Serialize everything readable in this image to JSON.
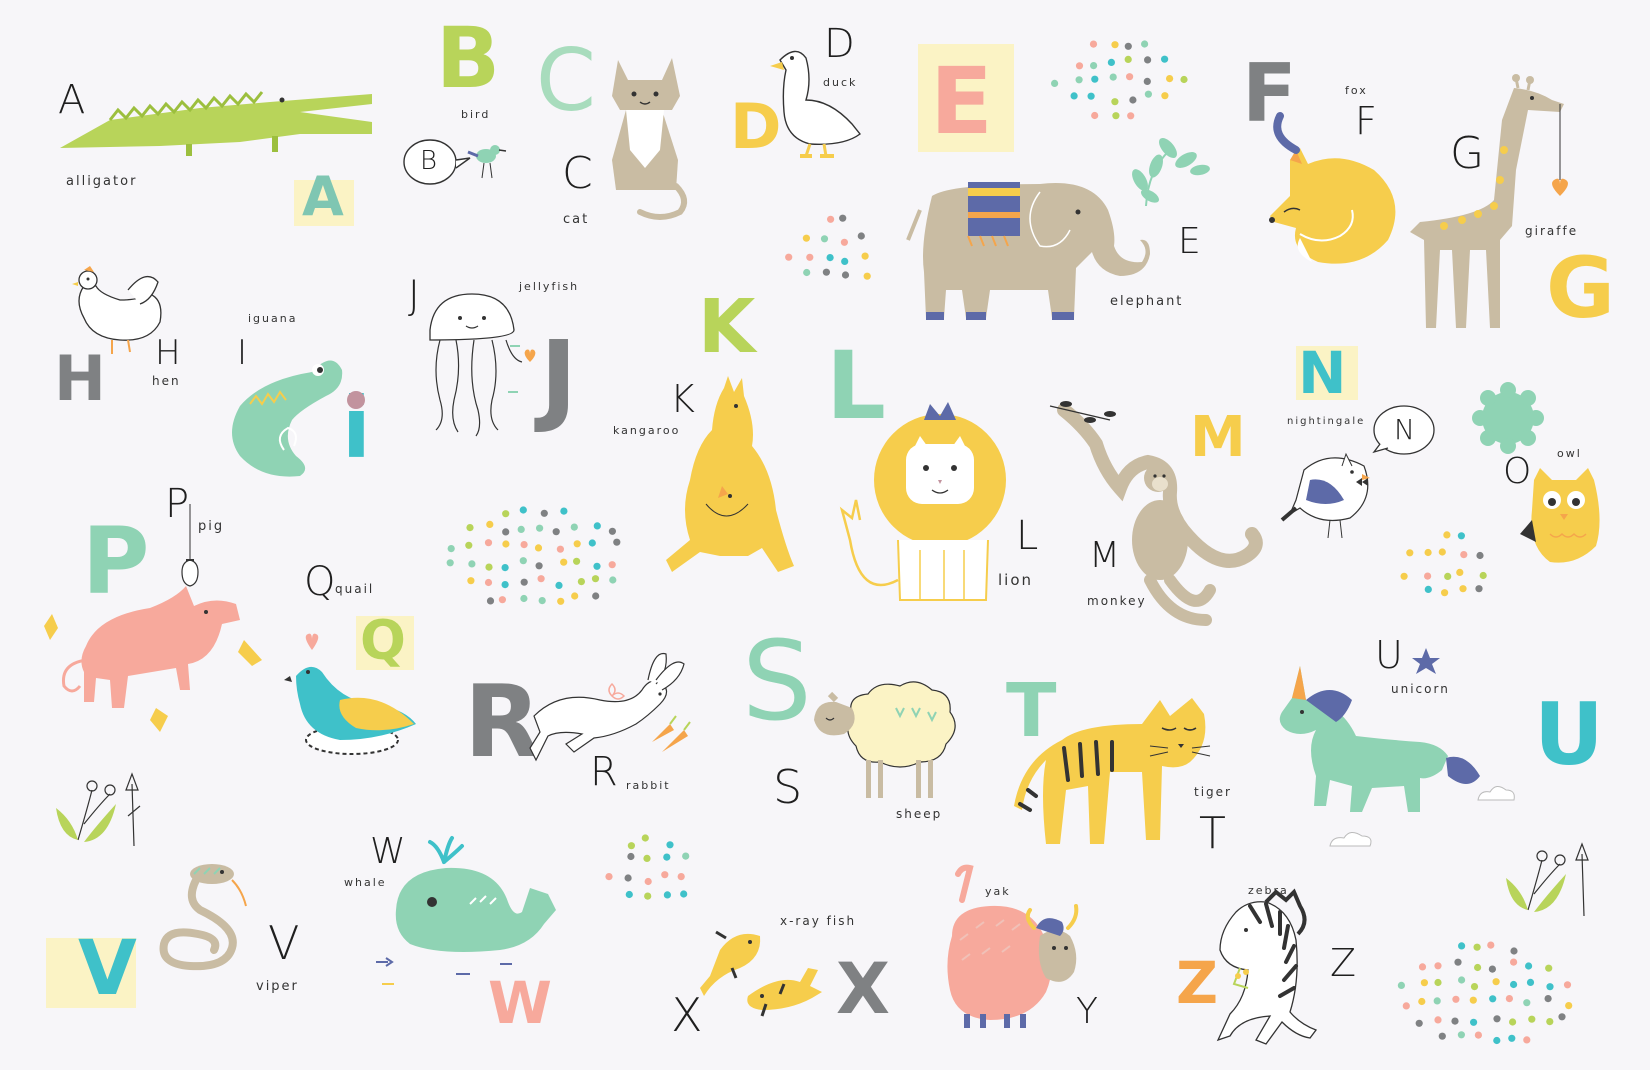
{
  "palette": {
    "green": "#b8d45a",
    "mint": "#8fd3b4",
    "teal": "#3fc1c9",
    "yellow": "#f6cd4c",
    "orange": "#f5a54b",
    "pink": "#f7a99c",
    "tan": "#c9bca3",
    "gray": "#7f8183",
    "mauve": "#c2939e",
    "navy": "#5d6aa8",
    "cream": "#fbf3c5"
  },
  "words": [
    {
      "key": "alligator",
      "text": "Alligator"
    },
    {
      "key": "bird",
      "text": "Bird"
    },
    {
      "key": "cat",
      "text": "Cat"
    },
    {
      "key": "duck",
      "text": "Duck"
    },
    {
      "key": "elephant",
      "text": "Elephant"
    },
    {
      "key": "fox",
      "text": "Fox"
    },
    {
      "key": "giraffe",
      "text": "Giraffe"
    },
    {
      "key": "hen",
      "text": "Hen"
    },
    {
      "key": "iguana",
      "text": "Iguana"
    },
    {
      "key": "jellyfish",
      "text": "Jellyfish"
    },
    {
      "key": "kangaroo",
      "text": "Kangaroo"
    },
    {
      "key": "lion",
      "text": "Lion"
    },
    {
      "key": "monkey",
      "text": "Monkey"
    },
    {
      "key": "nightingale",
      "text": "Nightingale"
    },
    {
      "key": "owl",
      "text": "Owl"
    },
    {
      "key": "pig",
      "text": "Pig"
    },
    {
      "key": "quail",
      "text": "Quail"
    },
    {
      "key": "rabbit",
      "text": "Rabbit"
    },
    {
      "key": "sheep",
      "text": "Sheep"
    },
    {
      "key": "tiger",
      "text": "Tiger"
    },
    {
      "key": "unicorn",
      "text": "Unicorn"
    },
    {
      "key": "viper",
      "text": "Viper"
    },
    {
      "key": "whale",
      "text": "Whale"
    },
    {
      "key": "xrayfish",
      "text": "X-Ray Fish"
    },
    {
      "key": "yak",
      "text": "Yak"
    },
    {
      "key": "zebra",
      "text": "Zebra"
    }
  ],
  "small_letters": [
    "A",
    "B",
    "C",
    "D",
    "E",
    "F",
    "G",
    "H",
    "I",
    "J",
    "K",
    "L",
    "M",
    "N",
    "O",
    "P",
    "Q",
    "R",
    "S",
    "T",
    "U",
    "V",
    "W",
    "X",
    "Y",
    "Z"
  ],
  "big_letters": [
    "A",
    "B",
    "C",
    "D",
    "E",
    "F",
    "G",
    "H",
    "i",
    "J",
    "K",
    "L",
    "M",
    "N",
    "P",
    "Q",
    "R",
    "S",
    "T",
    "U",
    "V",
    "W",
    "X",
    "Z",
    "G"
  ],
  "speech_bubble_letters": {
    "bird": "B",
    "nightingale": "N"
  },
  "icons": [
    "alligator-icon",
    "bird-icon",
    "cat-icon",
    "duck-icon",
    "elephant-icon",
    "fox-icon",
    "giraffe-icon",
    "hen-icon",
    "iguana-icon",
    "jellyfish-icon",
    "kangaroo-icon",
    "lion-icon",
    "monkey-icon",
    "nightingale-icon",
    "owl-icon",
    "pig-icon",
    "quail-icon",
    "rabbit-icon",
    "sheep-icon",
    "tiger-icon",
    "unicorn-icon",
    "viper-icon",
    "whale-icon",
    "xray-fish-icon",
    "yak-icon",
    "zebra-icon",
    "confetti-dots-icon",
    "flower-icon",
    "leaf-icon",
    "cloud-icon",
    "star-icon"
  ]
}
